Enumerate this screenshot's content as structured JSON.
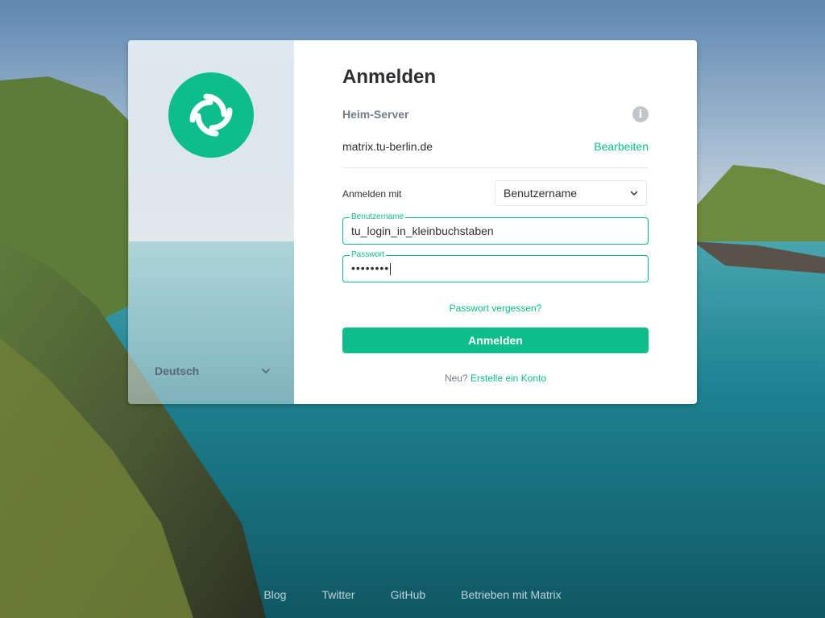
{
  "sidebar": {
    "logo_icon": "element-logo-icon",
    "language": "Deutsch"
  },
  "login": {
    "title": "Anmelden",
    "homeserver_label": "Heim-Server",
    "homeserver_value": "matrix.tu-berlin.de",
    "edit_label": "Bearbeiten",
    "login_with_label": "Anmelden mit",
    "login_with_selected": "Benutzername",
    "username_label": "Benutzername",
    "username_value": "tu_login_in_kleinbuchstaben",
    "password_label": "Passwort",
    "password_value": "••••••••",
    "forgot_password": "Passwort vergessen?",
    "submit_label": "Anmelden",
    "new_prefix": "Neu?",
    "create_account": "Erstelle ein Konto"
  },
  "footer": {
    "links": [
      "Blog",
      "Twitter",
      "GitHub",
      "Betrieben mit Matrix"
    ]
  },
  "colors": {
    "accent": "#0dbd8b",
    "text": "#2e2f32",
    "muted": "#737d8c"
  }
}
